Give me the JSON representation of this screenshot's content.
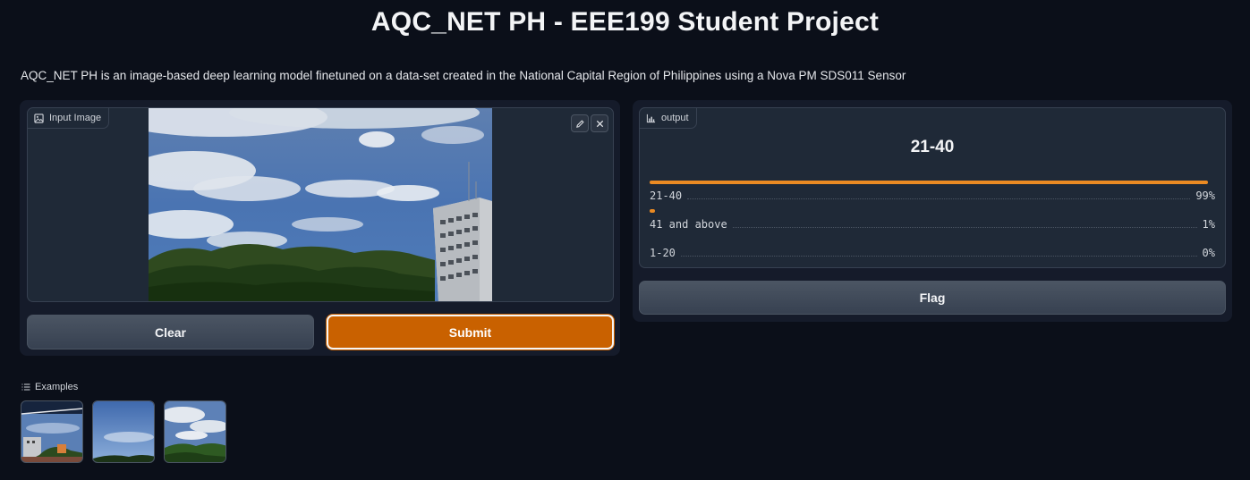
{
  "page": {
    "title": "AQC_NET PH - EEE199 Student Project",
    "description": "AQC_NET PH is an image-based deep learning model finetuned on a data-set created in the National Capital Region of Philippines using a Nova PM SDS011 Sensor"
  },
  "input": {
    "label": "Input Image",
    "label_icon": "image-icon",
    "edit_icon": "pencil-icon",
    "close_icon": "close-icon"
  },
  "buttons": {
    "clear": "Clear",
    "submit": "Submit",
    "flag": "Flag"
  },
  "output": {
    "label": "output",
    "label_icon": "bar-chart-icon",
    "top_label": "21-40",
    "confidences": [
      {
        "label": "21-40",
        "percent_text": "99%",
        "value": 0.99
      },
      {
        "label": "41 and above",
        "percent_text": "1%",
        "value": 0.01
      },
      {
        "label": "1-20",
        "percent_text": "0%",
        "value": 0.0
      }
    ]
  },
  "examples": {
    "label": "Examples",
    "label_icon": "list-icon",
    "count": 3
  },
  "colors": {
    "background": "#0b0f19",
    "accent": "#c96100",
    "bar": "#ea8a23"
  }
}
